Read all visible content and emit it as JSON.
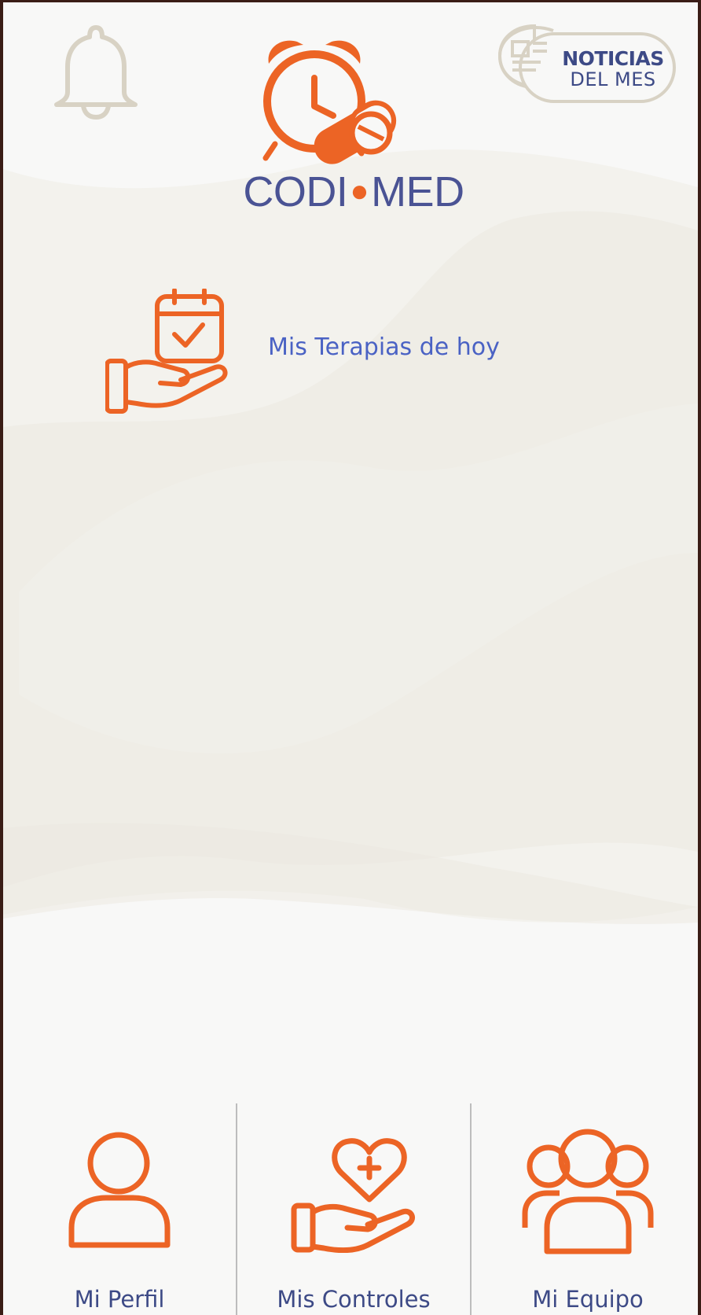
{
  "app": {
    "logo_text_left": "CODI",
    "logo_text_right": "MED"
  },
  "header": {
    "bell_icon": "bell-icon",
    "news_button": {
      "line1": "NOTICIAS",
      "line2": "DEL MES",
      "icon": "newspaper-icon"
    }
  },
  "main": {
    "therapy": {
      "label": "Mis Terapias de hoy",
      "icon": "hand-calendar-check-icon"
    }
  },
  "bottom_nav": {
    "items": [
      {
        "label": "Mi Perfil",
        "icon": "user-icon"
      },
      {
        "label": "Mis Controles",
        "icon": "hand-heart-plus-icon"
      },
      {
        "label": "Mi Equipo",
        "icon": "team-icon"
      }
    ]
  },
  "colors": {
    "accent": "#ec6425",
    "brand_text": "#4a5394",
    "link_text": "#4a62c4",
    "muted_icon": "#d8d2c4",
    "background": "#f8f8f7"
  }
}
